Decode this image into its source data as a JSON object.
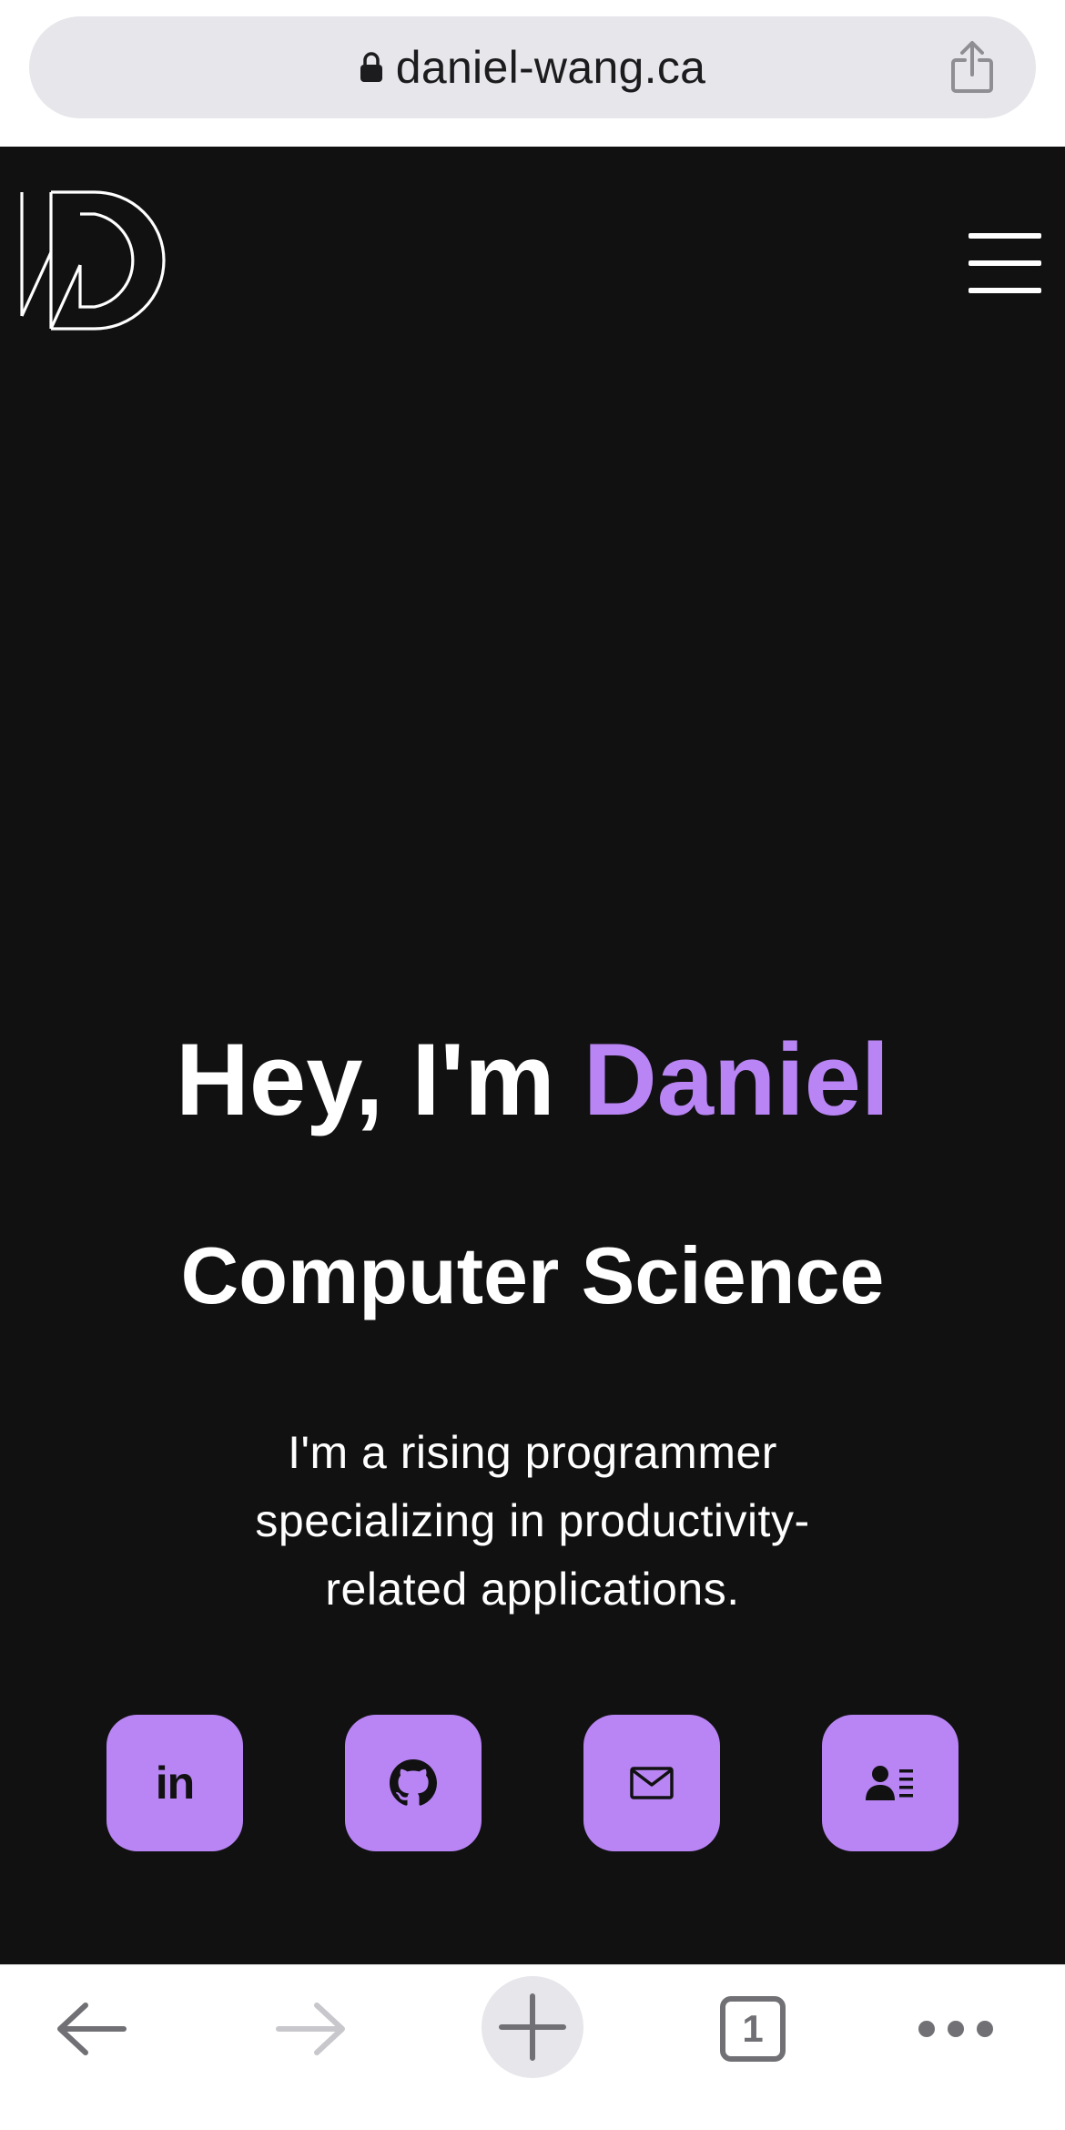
{
  "browser": {
    "url": "daniel-wang.ca",
    "tab_count": "1"
  },
  "site": {
    "hero": {
      "greeting": "Hey, I'm ",
      "name": "Daniel",
      "subtitle": "Computer Science",
      "description": "I'm a rising programmer specializing in productivity-related applications."
    },
    "social": [
      {
        "icon": "linkedin-icon",
        "label": "in"
      },
      {
        "icon": "github-icon"
      },
      {
        "icon": "mail-icon"
      },
      {
        "icon": "resume-icon"
      }
    ]
  },
  "colors": {
    "background": "#111112",
    "accent": "#b985f4",
    "text": "#ffffff",
    "browser_chrome": "#e6e6eb"
  }
}
